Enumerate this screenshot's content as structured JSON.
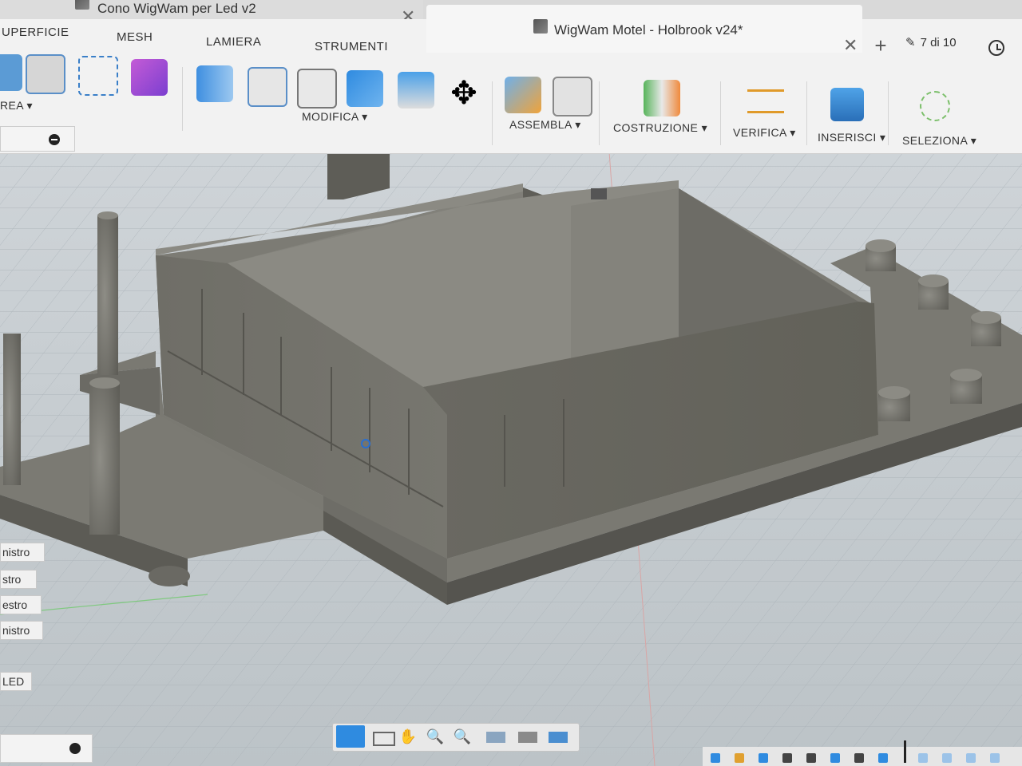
{
  "tabs": [
    {
      "label": "Cono WigWam per Led v2",
      "active": false
    },
    {
      "label": "WigWam Motel - Holbrook v24*",
      "active": true
    }
  ],
  "job_status": {
    "text": "7 di 10"
  },
  "workspace_tabs": [
    "UPERFICIE",
    "MESH",
    "LAMIERA",
    "STRUMENTI"
  ],
  "toolbar_groups": [
    {
      "label": "REA ▾",
      "icon": "create-icon"
    },
    {
      "label": "MODIFICA ▾",
      "icon": "modify-icon"
    },
    {
      "label": "ASSEMBLA ▾",
      "icon": "assemble-icon"
    },
    {
      "label": "COSTRUZIONE ▾",
      "icon": "construct-icon"
    },
    {
      "label": "VERIFICA ▾",
      "icon": "inspect-icon"
    },
    {
      "label": "INSERISCI ▾",
      "icon": "insert-icon"
    },
    {
      "label": "SELEZIONA ▾",
      "icon": "select-icon"
    }
  ],
  "side_buttons": [
    "nistro",
    "stro",
    "estro",
    "nistro",
    "LED"
  ],
  "colors": {
    "accent": "#1a8ee0",
    "toolbar_bg": "#f2f2f2",
    "model_gray": "#7d7c75",
    "grid_bg": "#c7ccd0"
  }
}
